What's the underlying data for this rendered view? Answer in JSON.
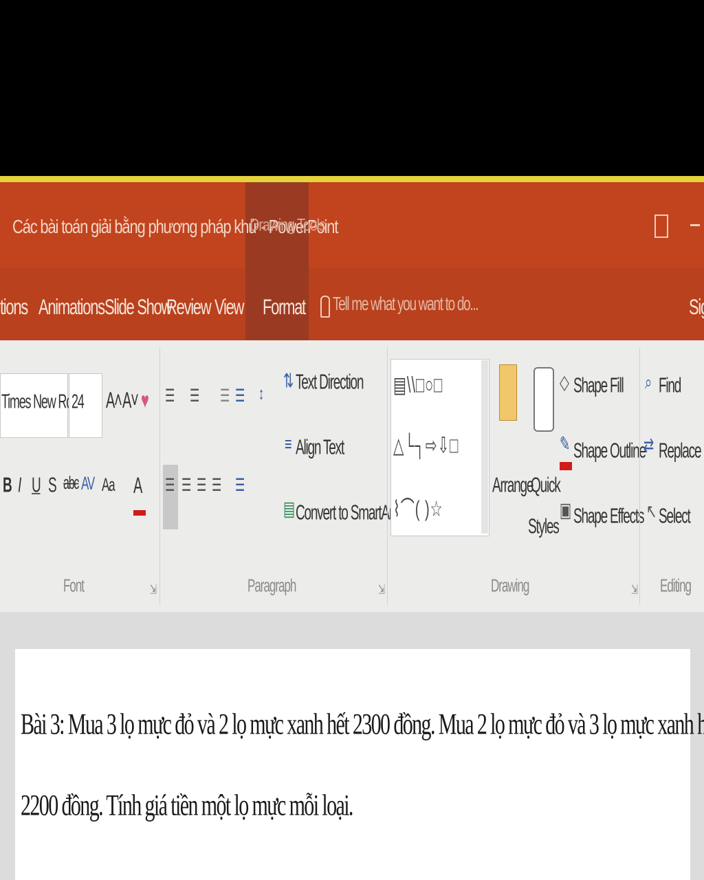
{
  "window": {
    "title": "Các bài toán giải bằng phương pháp khử - PowerPoint",
    "context_group": "Drawing Tools"
  },
  "tabs": [
    {
      "label": "tions"
    },
    {
      "label": "Animations"
    },
    {
      "label": "Slide Show"
    },
    {
      "label": "Review"
    },
    {
      "label": "View"
    },
    {
      "label": "Format",
      "active": true
    }
  ],
  "tell_me": {
    "placeholder": "Tell me what you want to do..."
  },
  "sign_in": "Sig",
  "font_group": {
    "font_name": "Times New Ror",
    "font_size": "24",
    "label": "Font"
  },
  "paragraph_group": {
    "text_direction": "Text Direction",
    "align_text": "Align Text",
    "convert_smartart": "Convert to SmartArt",
    "label": "Paragraph"
  },
  "drawing_group": {
    "arrange": "Arrange",
    "quick": "Quick",
    "styles": "Styles",
    "shape_fill": "Shape Fill",
    "shape_outline": "Shape Outline",
    "shape_effects": "Shape Effects",
    "label": "Drawing"
  },
  "editing_group": {
    "find": "Find",
    "replace": "Replace",
    "select": "Select",
    "label": "Editing"
  },
  "slide": {
    "line1": "Bài 3: Mua 3 lọ mực đỏ và 2 lọ mực xanh hết 2300 đồng. Mua 2 lọ mực đỏ và 3 lọ mực xanh hết",
    "line2": "2200 đồng. Tính giá tiền một lọ mực mỗi loại."
  },
  "colors": {
    "title_bar": "#c1441e",
    "context_tab": "#9b3a22",
    "ribbon": "#ececea",
    "accent_yellow": "#e6d23c",
    "font_color_red": "#d11a1a"
  }
}
